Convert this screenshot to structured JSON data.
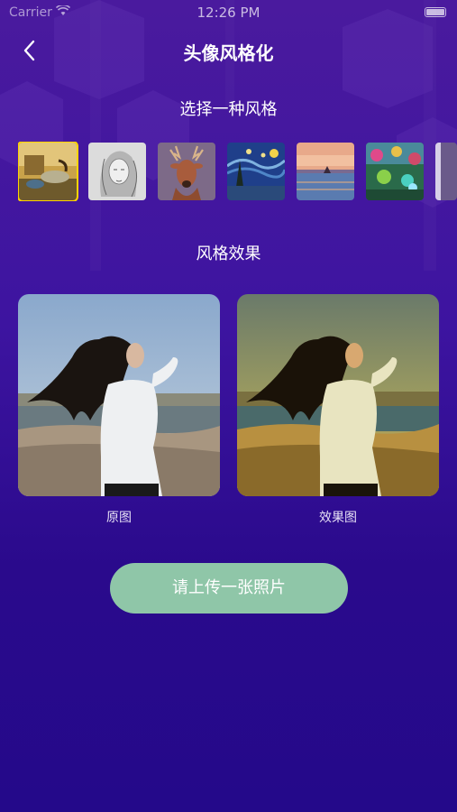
{
  "status_bar": {
    "carrier": "Carrier",
    "time": "12:26 PM"
  },
  "nav": {
    "title": "头像风格化"
  },
  "style_picker": {
    "heading": "选择一种风格",
    "styles": [
      {
        "icon": "surreal-clock-painting-thumb",
        "selected": true
      },
      {
        "icon": "pencil-sketch-portrait-thumb",
        "selected": false
      },
      {
        "icon": "deer-painting-thumb",
        "selected": false
      },
      {
        "icon": "starry-night-thumb",
        "selected": false
      },
      {
        "icon": "sunset-seascape-thumb",
        "selected": false
      },
      {
        "icon": "fantasy-garden-thumb",
        "selected": false
      }
    ]
  },
  "result": {
    "heading": "风格效果",
    "original_caption": "原图",
    "effect_caption": "效果图"
  },
  "upload_button": {
    "label": "请上传一张照片"
  },
  "colors": {
    "accent_selected": "#ffd400",
    "button_bg": "#8fc6a8",
    "background_top": "#4a1a9e",
    "background_bottom": "#24098a"
  }
}
